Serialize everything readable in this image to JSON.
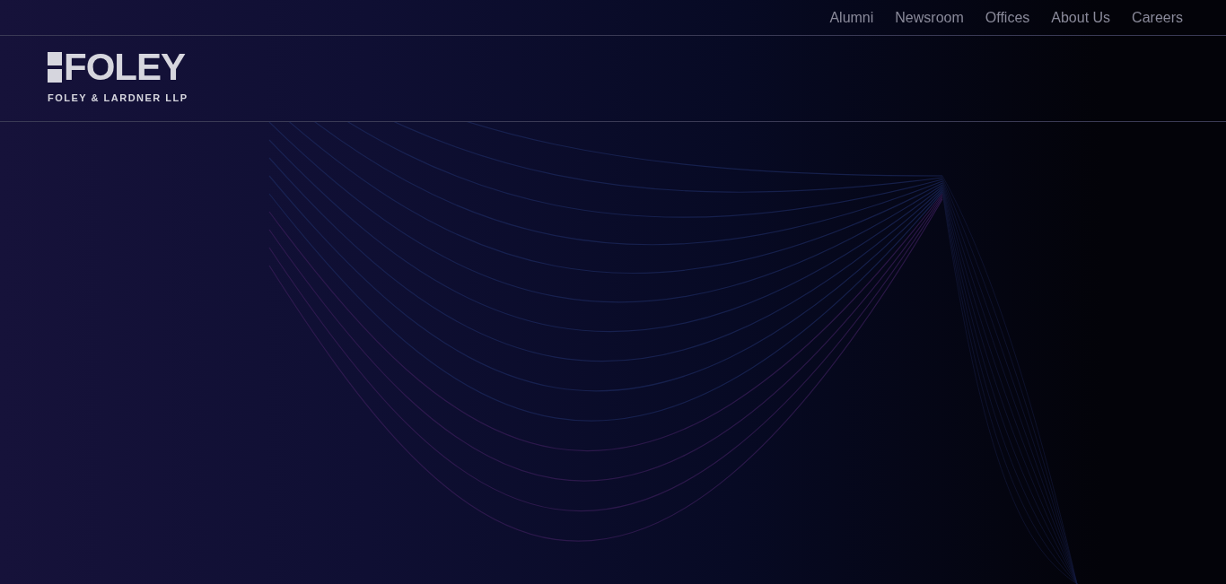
{
  "top_nav": [
    {
      "label": "Alumni"
    },
    {
      "label": "Newsroom"
    },
    {
      "label": "Offices"
    },
    {
      "label": "About Us"
    },
    {
      "label": "Careers"
    }
  ],
  "logo": {
    "wordmark": "FOLEY",
    "subtitle": "FOLEY & LARDNER LLP"
  }
}
